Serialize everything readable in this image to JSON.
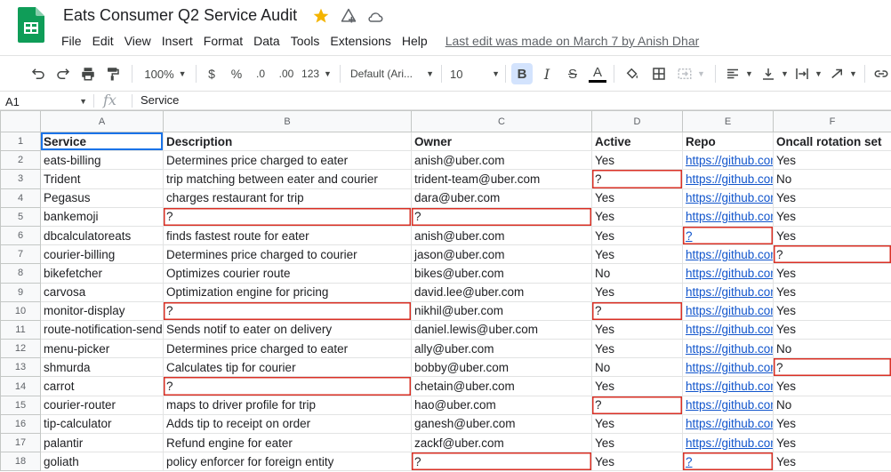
{
  "doc": {
    "title": "Eats Consumer Q2 Service Audit",
    "last_edit": "Last edit was made on March 7 by Anish Dhar"
  },
  "menu": [
    "File",
    "Edit",
    "View",
    "Insert",
    "Format",
    "Data",
    "Tools",
    "Extensions",
    "Help"
  ],
  "toolbar": {
    "zoom": "100%",
    "currency": "$",
    "percent": "%",
    "decrease_decimal": ".0",
    "increase_decimal": ".00",
    "number_format": "123",
    "font_family": "Default (Ari...",
    "font_size": "10",
    "bold": "B",
    "italic": "I",
    "strike": "S",
    "text_color": "A"
  },
  "formula_bar": {
    "cell_ref": "A1",
    "fx": "fx",
    "value": "Service"
  },
  "colors": {
    "accent": "#1a73e8",
    "missing_border": "#d93025",
    "link": "#1155cc",
    "star": "#f4b400",
    "sheets_green": "#0f9d58"
  },
  "icons": [
    "sheets-logo-icon",
    "star-icon",
    "move-to-folder-icon",
    "cloud-saved-icon",
    "undo-icon",
    "redo-icon",
    "print-icon",
    "paint-format-icon",
    "fill-color-icon",
    "borders-icon",
    "merge-cells-icon",
    "align-left-icon",
    "vertical-align-icon",
    "text-wrap-icon",
    "text-rotation-icon",
    "insert-link-icon"
  ],
  "sheet": {
    "col_letters": [
      "A",
      "B",
      "C",
      "D",
      "E",
      "F"
    ],
    "header": [
      "Service",
      "Description",
      "Owner",
      "Active",
      "Repo",
      "Oncall rotation set"
    ],
    "rows": [
      [
        "eats-billing",
        "Determines price charged to eater",
        "anish@uber.com",
        "Yes",
        "https://github.com",
        "Yes"
      ],
      [
        "Trident",
        "trip matching between eater and courier",
        "trident-team@uber.com",
        "?",
        "https://github.com",
        "No"
      ],
      [
        "Pegasus",
        "charges restaurant for trip",
        "dara@uber.com",
        "Yes",
        "https://github.com",
        "Yes"
      ],
      [
        "bankemoji",
        "?",
        "?",
        "Yes",
        "https://github.com",
        "Yes"
      ],
      [
        "dbcalculatoreats",
        "finds fastest route for eater",
        "anish@uber.com",
        "Yes",
        "?",
        "Yes"
      ],
      [
        "courier-billing",
        "Determines price charged to courier",
        "jason@uber.com",
        "Yes",
        "https://github.com",
        "?"
      ],
      [
        "bikefetcher",
        "Optimizes courier route",
        "bikes@uber.com",
        "No",
        "https://github.com",
        "Yes"
      ],
      [
        "carvosa",
        "Optimization engine for pricing",
        "david.lee@uber.com",
        "Yes",
        "https://github.com",
        "Yes"
      ],
      [
        "monitor-display",
        "?",
        "nikhil@uber.com",
        "?",
        "https://github.com",
        "Yes"
      ],
      [
        "route-notification-sender",
        "Sends notif to eater on delivery",
        "daniel.lewis@uber.com",
        "Yes",
        "https://github.com",
        "Yes"
      ],
      [
        "menu-picker",
        "Determines price charged to eater",
        "ally@uber.com",
        "Yes",
        "https://github.com",
        "No"
      ],
      [
        "shmurda",
        "Calculates tip for courier",
        "bobby@uber.com",
        "No",
        "https://github.com",
        "?"
      ],
      [
        "carrot",
        "?",
        "chetain@uber.com",
        "Yes",
        "https://github.com",
        "Yes"
      ],
      [
        "courier-router",
        "maps to driver profile for trip",
        "hao@uber.com",
        "?",
        "https://github.com",
        "No"
      ],
      [
        "tip-calculator",
        "Adds tip to receipt on order",
        "ganesh@uber.com",
        "Yes",
        "https://github.com",
        "Yes"
      ],
      [
        "palantir",
        "Refund engine for eater",
        "zackf@uber.com",
        "Yes",
        "https://github.com",
        "Yes"
      ],
      [
        "goliath",
        "policy enforcer for foreign entity",
        "?",
        "Yes",
        "?",
        "Yes"
      ]
    ]
  }
}
